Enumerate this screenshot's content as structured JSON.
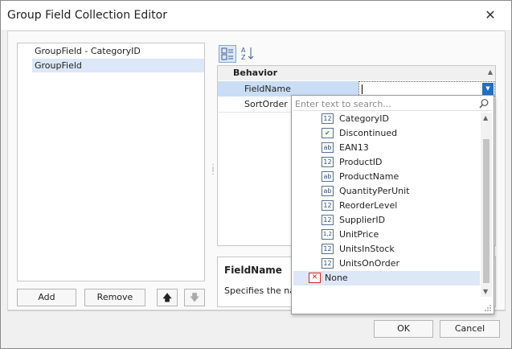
{
  "window": {
    "title": "Group Field Collection Editor",
    "close_glyph": "✕"
  },
  "list": {
    "items": [
      "GroupField - CategoryID",
      "GroupField"
    ]
  },
  "buttons": {
    "add": "Add",
    "remove": "Remove",
    "ok": "OK",
    "cancel": "Cancel",
    "up_glyph": "🡅",
    "down_glyph": "🡇"
  },
  "grid": {
    "category": "Behavior",
    "properties": [
      {
        "name": "FieldName"
      },
      {
        "name": "SortOrder"
      }
    ]
  },
  "description": {
    "title": "FieldName",
    "text": "Specifies the name"
  },
  "dropdown": {
    "search_placeholder": "Enter text to search...",
    "items": [
      {
        "label": "CategoryID",
        "icon": "12"
      },
      {
        "label": "Discontinued",
        "icon": "✔"
      },
      {
        "label": "EAN13",
        "icon": "ab"
      },
      {
        "label": "ProductID",
        "icon": "12"
      },
      {
        "label": "ProductName",
        "icon": "ab"
      },
      {
        "label": "QuantityPerUnit",
        "icon": "ab"
      },
      {
        "label": "ReorderLevel",
        "icon": "12"
      },
      {
        "label": "SupplierID",
        "icon": "12"
      },
      {
        "label": "UnitPrice",
        "icon": "1,2"
      },
      {
        "label": "UnitsInStock",
        "icon": "12"
      },
      {
        "label": "UnitsOnOrder",
        "icon": "12"
      },
      {
        "label": "None",
        "icon": "✕"
      }
    ]
  },
  "colors": {
    "selection": "#dce7f7",
    "accent": "#1e6fc5",
    "none_icon": "#d0281e",
    "check_icon": "#3c8d3c"
  }
}
